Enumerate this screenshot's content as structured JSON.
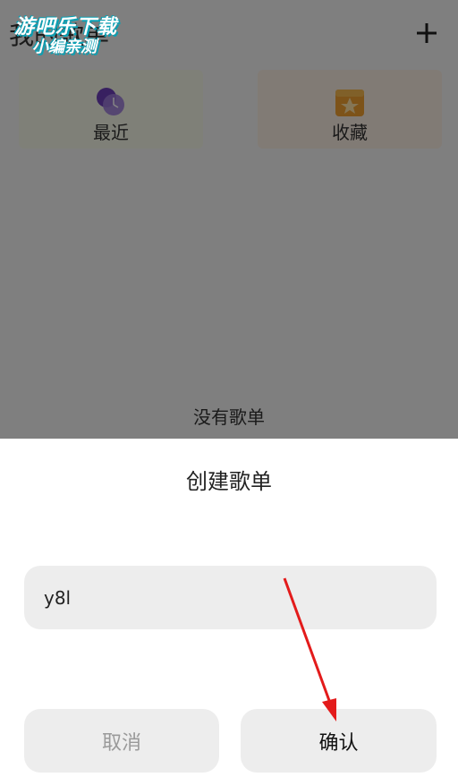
{
  "header": {
    "title": "我的歌单",
    "add_icon": "plus-icon"
  },
  "cards": [
    {
      "label": "最近",
      "icon": "clock-icon",
      "bg": "#f3f5e7"
    },
    {
      "label": "收藏",
      "icon": "star-folder-icon",
      "bg": "#f8ebe0"
    }
  ],
  "empty_text": "没有歌单",
  "watermark": {
    "line1": "游吧乐下载",
    "line2": "小编亲测"
  },
  "dialog": {
    "title": "创建歌单",
    "input_value": "y8l",
    "cancel_label": "取消",
    "confirm_label": "确认"
  },
  "colors": {
    "overlay": "rgba(0,0,0,0.48)",
    "accent_arrow": "#e31b1b",
    "button_bg": "#ededed"
  }
}
